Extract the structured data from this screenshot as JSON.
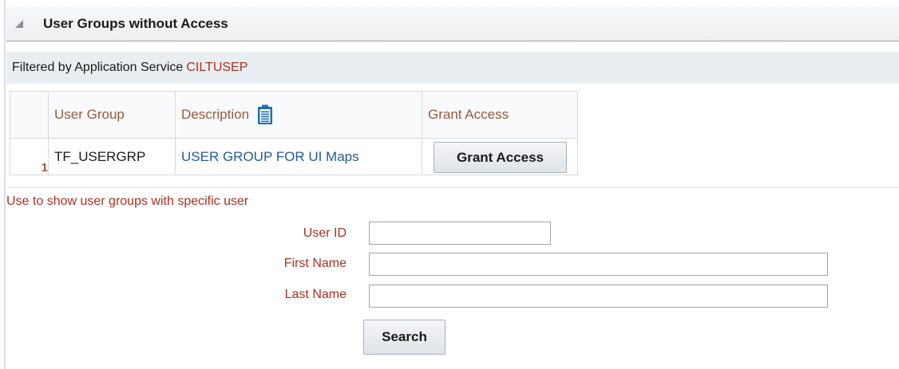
{
  "section": {
    "title": "User Groups without Access"
  },
  "filter": {
    "label": "Filtered by Application Service",
    "value": "CILTUSEP"
  },
  "table": {
    "headers": {
      "user_group": "User Group",
      "description": "Description",
      "grant_access": "Grant Access"
    },
    "rows": [
      {
        "num": "1",
        "user_group": "TF_USERGRP",
        "description": "USER GROUP FOR UI Maps",
        "action": "Grant Access"
      }
    ]
  },
  "search_form": {
    "hint": "Use to show user groups with specific user",
    "user_id_label": "User ID",
    "first_name_label": "First Name",
    "last_name_label": "Last Name",
    "user_id_value": "",
    "first_name_value": "",
    "last_name_value": "",
    "search_label": "Search"
  },
  "colors": {
    "accent_text": "#a8321e",
    "link": "#1f5d97",
    "icon_blue": "#1f6fb5"
  },
  "icons": {
    "collapse": "triangle-collapse-icon",
    "description": "clipboard-icon"
  }
}
